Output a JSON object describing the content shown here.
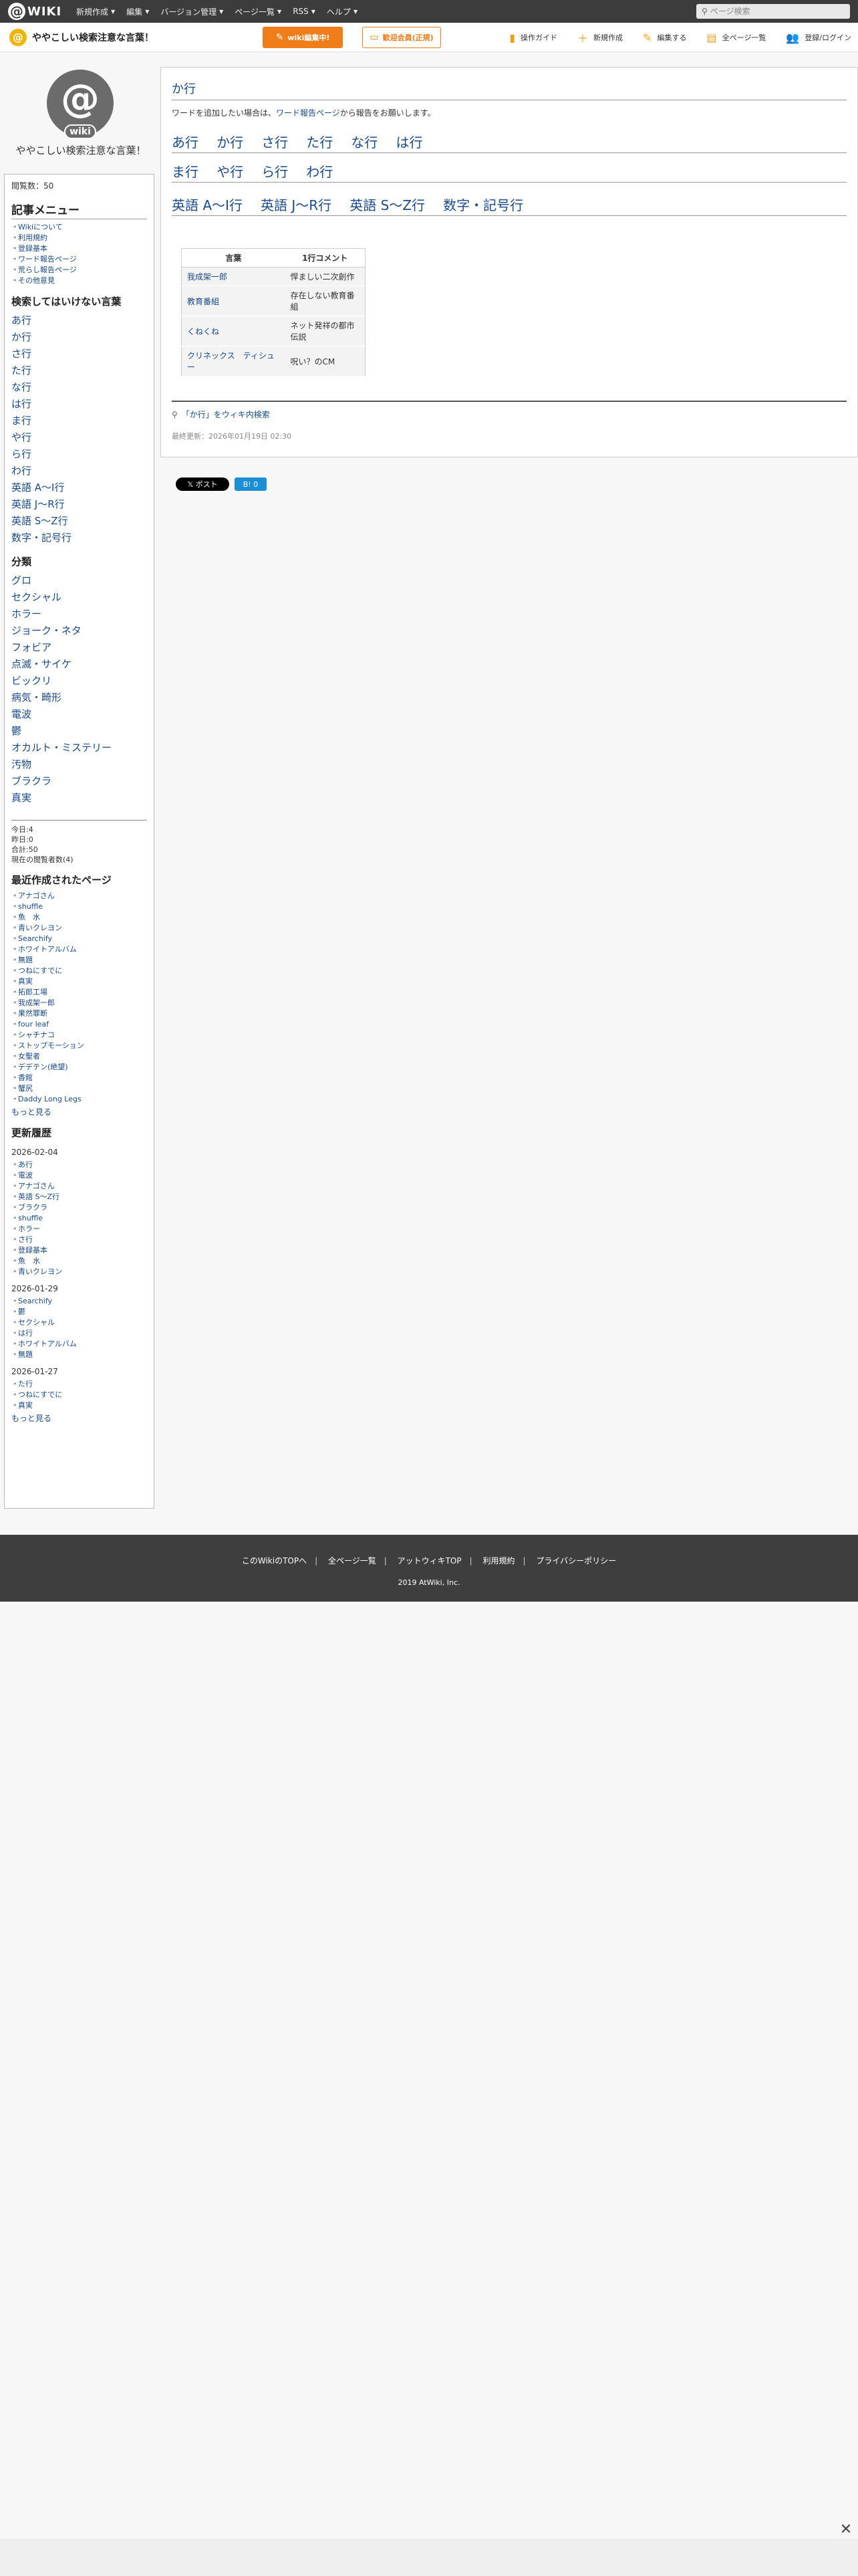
{
  "topnav": {
    "logo_mark": "@",
    "logo_text": "WIKI",
    "menu": [
      "新規作成",
      "編集",
      "バージョン管理",
      "ページ一覧",
      "RSS",
      "ヘルプ"
    ],
    "search_placeholder": "ページ検索"
  },
  "subheader": {
    "wiki_title": "ややこしい検索注意な言葉！",
    "edit_button": "wiki編集中!",
    "member_button": "歓迎会員(正規)",
    "actions": [
      "操作ガイド",
      "新規作成",
      "編集する",
      "全ページ一覧",
      "登録/ログイン"
    ]
  },
  "sidebar": {
    "avatar_at": "@",
    "avatar_wiki": "wiki",
    "wiki_name": "ややこしい検索注意な言葉！",
    "views": "閲覧数：50",
    "menu_heading": "記事メニュー",
    "menu_items": [
      "Wikiについて",
      "利用規約",
      "登録基本",
      "ワード報告ページ",
      "荒らし報告ページ",
      "その他意見"
    ],
    "kensaku_heading": "検索してはいけない言葉",
    "kensaku_items": [
      "あ行",
      "か行",
      "さ行",
      "た行",
      "な行",
      "は行",
      "ま行",
      "や行",
      "ら行",
      "わ行",
      "英語 A〜I行",
      "英語 J〜R行",
      "英語 S〜Z行",
      "数字・記号行"
    ],
    "bunrui_heading": "分類",
    "bunrui_items": [
      "グロ",
      "セクシャル",
      "ホラー",
      "ジョーク・ネタ",
      "フォビア",
      "点滅・サイケ",
      "ビックリ",
      "病気・畸形",
      "電波",
      "鬱",
      "オカルト・ミステリー",
      "汚物",
      "ブラクラ",
      "真実"
    ],
    "counter": [
      "今日:4",
      "昨日:0",
      "合計:50",
      "現在の閲覧者数(4)"
    ],
    "recent_heading": "最近作成されたページ",
    "recent_items": [
      "アナゴさん",
      "shuffle",
      "魚　水",
      "青いクレヨン",
      "Searchify",
      "ホワイトアルバム",
      "無題",
      "つねにすでに",
      "真実",
      "拓郎工場",
      "我成架一郎",
      "果然罪断",
      "four leaf",
      "シャチナコ",
      "ストップモーション",
      "女聖者",
      "デデテン(絶望)",
      "香館",
      "蟹尻",
      "Daddy Long Legs"
    ],
    "recent_more": "もっと見る",
    "history_heading": "更新履歴",
    "history": [
      {
        "date": "2026-02-04",
        "items": [
          "あ行",
          "電波",
          "アナゴさん",
          "英語 S〜Z行",
          "ブラクラ",
          "shuffle",
          "ホラー",
          "さ行",
          "登録基本",
          "魚　水",
          "青いクレヨン"
        ]
      },
      {
        "date": "2026-01-29",
        "items": [
          "Searchify",
          "鬱",
          "セクシャル",
          "は行",
          "ホワイトアルバム",
          "無題"
        ]
      },
      {
        "date": "2026-01-27",
        "items": [
          "た行",
          "つねにすでに",
          "真実"
        ]
      }
    ],
    "history_more": "もっと見る"
  },
  "main": {
    "title": "か行",
    "intro_before": "ワードを追加したい場合は、",
    "intro_link": "ワード報告ページ",
    "intro_after": "から報告をお願いします。",
    "row1": [
      "あ行",
      "か行",
      "さ行",
      "た行",
      "な行",
      "は行"
    ],
    "row2": [
      "ま行",
      "や行",
      "ら行",
      "わ行"
    ],
    "row3": [
      "英語 A〜I行",
      "英語 J〜R行",
      "英語 S〜Z行",
      "数字・記号行"
    ],
    "table": {
      "headers": [
        "言葉",
        "1行コメント"
      ],
      "rows": [
        {
          "word": "我成架一郎",
          "word2": "",
          "comment": "悍ましい二次創作"
        },
        {
          "word": "教育番組",
          "word2": "",
          "comment": "存在しない教育番組"
        },
        {
          "word": "くねくね",
          "word2": "",
          "comment": "ネット発祥の都市伝説"
        },
        {
          "word": "クリネックス",
          "word2": "ティシュー",
          "comment": "呪い？のCM"
        }
      ]
    },
    "search_link": "「か行」をウィキ内検索",
    "updated": "最終更新：2026年01月19日 02:30",
    "x_button": "𝕏 ポスト",
    "hatena_button": "B! 0"
  },
  "footer": {
    "links": [
      "このWikiのTOPへ",
      "全ページ一覧",
      "アットウィキTOP",
      "利用規約",
      "プライバシーポリシー"
    ],
    "copyright": "2019 AtWiki, Inc."
  },
  "colors": {
    "accent": "#f07c1a",
    "link": "#1a4a8a",
    "nav": "#3c3c3c"
  }
}
